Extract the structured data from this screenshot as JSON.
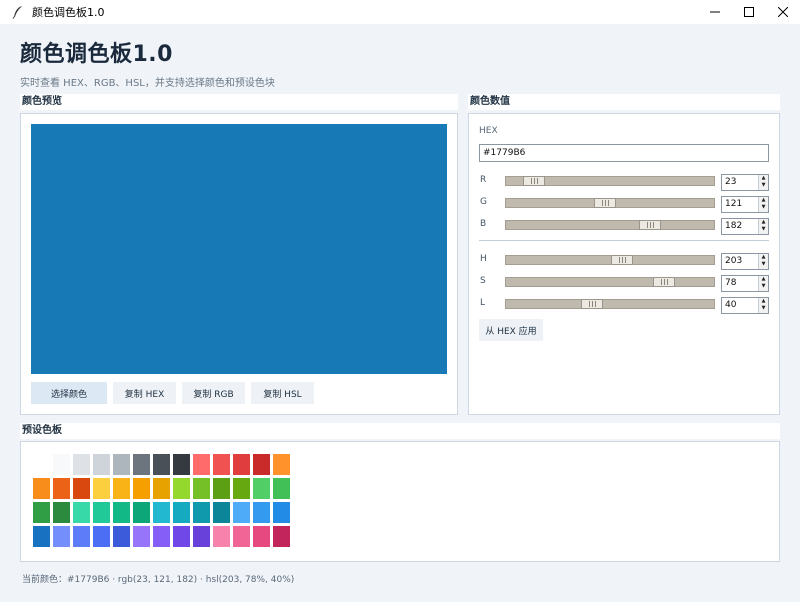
{
  "window": {
    "title": "颜色调色板1.0"
  },
  "header": {
    "title": "颜色调色板1.0",
    "subtitle": "实时查看 HEX、RGB、HSL，并支持选择颜色和预设色块"
  },
  "preview": {
    "label": "颜色预览",
    "color": "#1779B6",
    "buttons": {
      "choose": "选择颜色",
      "copy_hex": "复制 HEX",
      "copy_rgb": "复制 RGB",
      "copy_hsl": "复制 HSL"
    }
  },
  "values": {
    "label": "颜色数值",
    "hex_label": "HEX",
    "hex": "#1779B6",
    "rgb": [
      {
        "label": "R",
        "value": "23",
        "level": 0.09
      },
      {
        "label": "G",
        "value": "121",
        "level": 0.47
      },
      {
        "label": "B",
        "value": "182",
        "level": 0.71
      }
    ],
    "hsl": [
      {
        "label": "H",
        "value": "203",
        "level": 0.56
      },
      {
        "label": "S",
        "value": "78",
        "level": 0.78
      },
      {
        "label": "L",
        "value": "40",
        "level": 0.4
      }
    ],
    "apply_button": "从 HEX 应用"
  },
  "palette": {
    "label": "预设色板",
    "colors": [
      "#FFFFFF",
      "#F8F9FA",
      "#DEE2E6",
      "#CED4DA",
      "#ADB5BD",
      "#6C757D",
      "#495057",
      "#343A40",
      "#FF6B6B",
      "#F05252",
      "#E03E3E",
      "#C92A2A",
      "#FF922B",
      "#F98D1C",
      "#EC6216",
      "#D9480F",
      "#FCCF3F",
      "#FAB317",
      "#F59F00",
      "#E8A200",
      "#94D82D",
      "#74C026",
      "#5C9E14",
      "#66A80F",
      "#51CF66",
      "#40C057",
      "#2F9E44",
      "#2B8A3E",
      "#38D9A9",
      "#20C997",
      "#12B886",
      "#0CA678",
      "#22B8CF",
      "#15AABF",
      "#1098AD",
      "#0C8599",
      "#4DABF7",
      "#339AF0",
      "#228BE6",
      "#1971C2",
      "#748FFC",
      "#5C7CFA",
      "#4C6EF5",
      "#3B5BDB",
      "#9775FA",
      "#845EF7",
      "#7048E8",
      "#6741D9",
      "#F783AC",
      "#F06595",
      "#E64980",
      "#C2255C"
    ]
  },
  "footer": {
    "status": "当前颜色：#1779B6 · rgb(23, 121, 182) · hsl(203, 78%, 40%)"
  }
}
